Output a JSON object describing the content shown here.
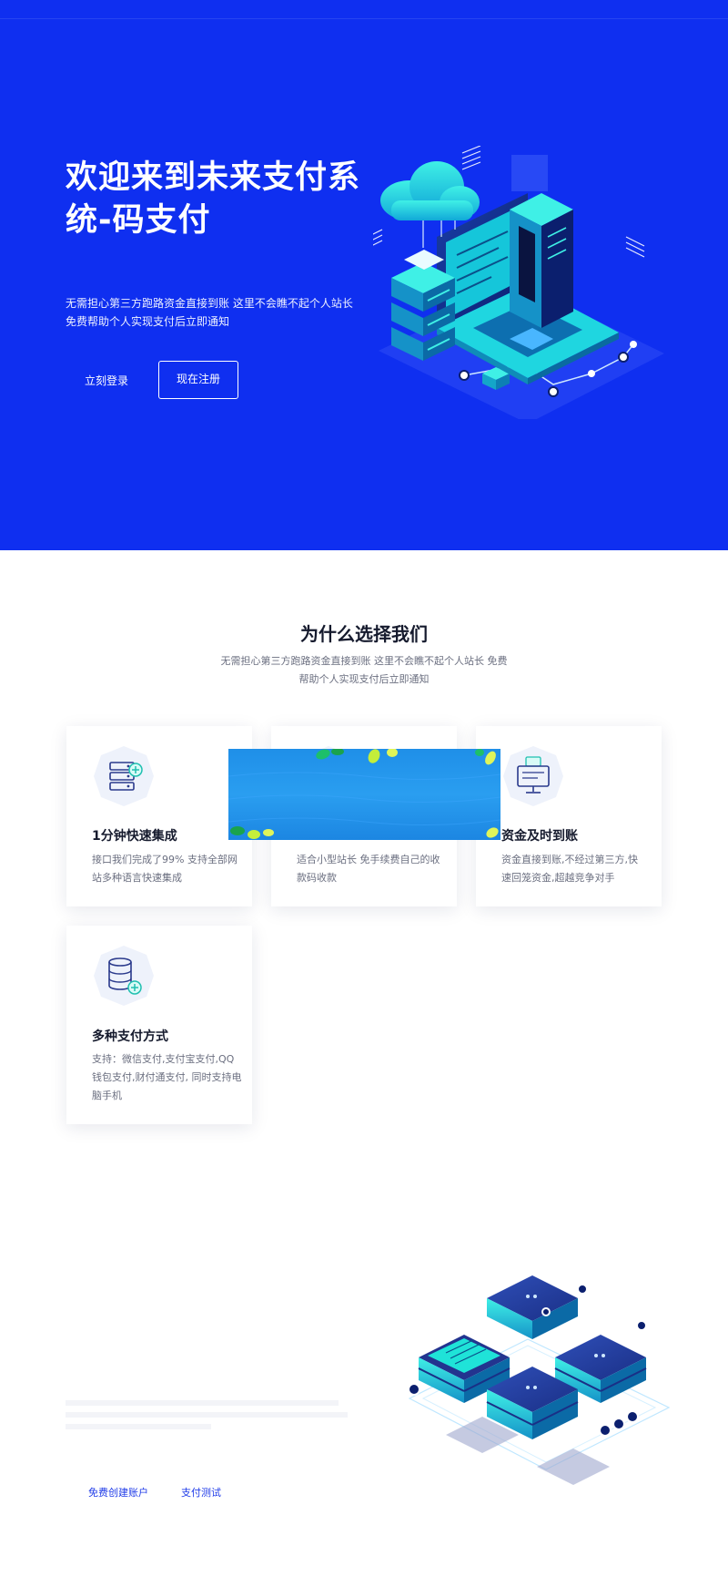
{
  "hero": {
    "title": "欢迎来到未来支付系统-码支付",
    "subtitle": "无需担心第三方跑路资金直接到账 这里不会瞧不起个人站长 免费帮助个人实现支付后立即通知",
    "login_label": "立刻登录",
    "register_label": "现在注册",
    "illustration_icon": "server-laptop-cloud-illustration"
  },
  "why": {
    "title": "为什么选择我们",
    "subtitle": "无需担心第三方跑路资金直接到账 这里不会瞧不起个人站长 免费帮助个人实现支付后立即通知"
  },
  "features": [
    {
      "icon": "server-icon",
      "title": "1分钟快速集成",
      "desc": "接口我们完成了99% 支持全部网站多种语言快速集成"
    },
    {
      "icon": "percent-icon",
      "title": "",
      "desc": "适合小型站长 免手续费自己的收款码收款"
    },
    {
      "icon": "monitor-icon",
      "title": "资金及时到账",
      "desc": "资金直接到账,不经过第三方,快速回笼资金,超越竞争对手"
    },
    {
      "icon": "database-icon",
      "title": "多种支付方式",
      "desc": "支持：微信支付,支付宝支付,QQ钱包支付,财付通支付, 同时支持电脑手机"
    }
  ],
  "overlay": {
    "icon": "leaf-banner-image"
  },
  "bottom": {
    "create_label": "免费创建账户",
    "test_label": "支付测试",
    "illustration_icon": "isometric-chips-illustration"
  },
  "colors": {
    "hero_bg": "#0f2ff0",
    "accent": "#1f3be8",
    "title_text": "#151a2d",
    "body_text": "#6b6f80",
    "cyan": "#1fe3d8"
  }
}
